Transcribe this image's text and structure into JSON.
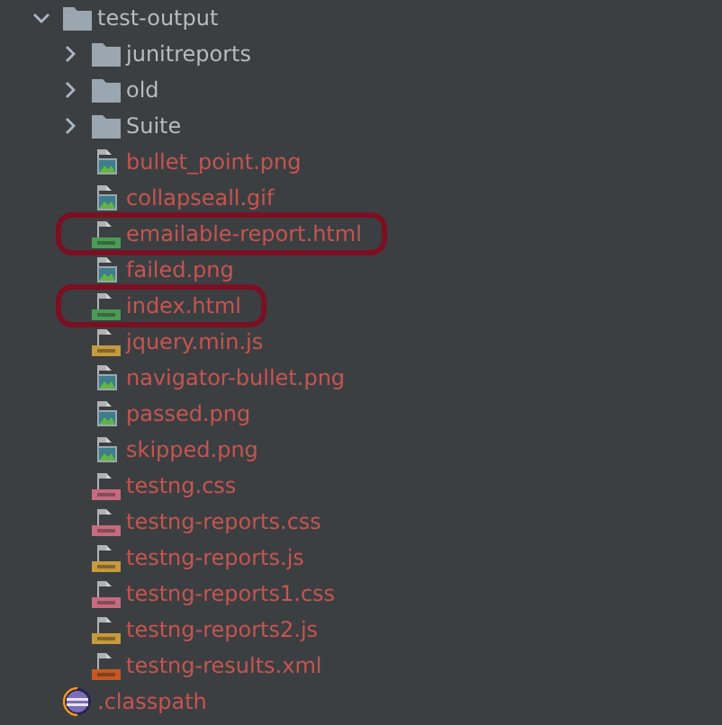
{
  "tree": [
    {
      "label": "test-output",
      "kind": "folder",
      "expanded": true,
      "children": [
        {
          "label": "junitreports",
          "kind": "folder",
          "expanded": false
        },
        {
          "label": "old",
          "kind": "folder",
          "expanded": false
        },
        {
          "label": "Suite",
          "kind": "folder",
          "expanded": false
        },
        {
          "label": "bullet_point.png",
          "kind": "image",
          "highlighted": false
        },
        {
          "label": "collapseall.gif",
          "kind": "image",
          "highlighted": false
        },
        {
          "label": "emailable-report.html",
          "kind": "html",
          "highlighted": true
        },
        {
          "label": "failed.png",
          "kind": "image",
          "highlighted": false
        },
        {
          "label": "index.html",
          "kind": "html",
          "highlighted": true
        },
        {
          "label": "jquery.min.js",
          "kind": "js",
          "highlighted": false
        },
        {
          "label": "navigator-bullet.png",
          "kind": "image",
          "highlighted": false
        },
        {
          "label": "passed.png",
          "kind": "image",
          "highlighted": false
        },
        {
          "label": "skipped.png",
          "kind": "image",
          "highlighted": false
        },
        {
          "label": "testng.css",
          "kind": "css",
          "highlighted": false
        },
        {
          "label": "testng-reports.css",
          "kind": "css",
          "highlighted": false
        },
        {
          "label": "testng-reports.js",
          "kind": "js",
          "highlighted": false
        },
        {
          "label": "testng-reports1.css",
          "kind": "css",
          "highlighted": false
        },
        {
          "label": "testng-reports2.js",
          "kind": "js",
          "highlighted": false
        },
        {
          "label": "testng-results.xml",
          "kind": "xml",
          "highlighted": false
        }
      ]
    },
    {
      "label": ".classpath",
      "kind": "classpath",
      "highlighted": false
    }
  ]
}
